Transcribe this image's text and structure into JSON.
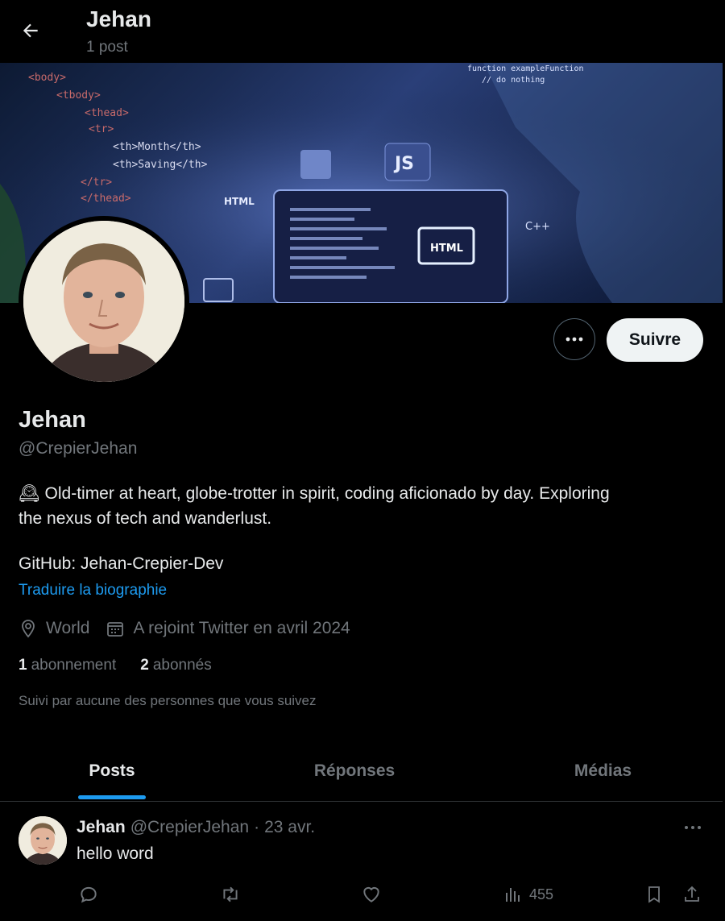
{
  "header": {
    "title": "Jehan",
    "subtitle": "1 post"
  },
  "banner": {
    "code_lines": [
      "<body>",
      "<tbody>",
      "<thead>",
      "<tr>",
      "<th>Month</th>",
      "<th>Saving</th>",
      "</tr>",
      "</thead>",
      "JS",
      "HTML",
      "HTML",
      "C++",
      "function exampleFunction",
      "// do nothing"
    ]
  },
  "profile": {
    "name": "Jehan",
    "handle": "@CrepierJehan",
    "bio_emoji": "🕰",
    "bio_line1": "Old-timer at heart, globe-trotter in spirit, coding aficionado by day. Exploring",
    "bio_line2": "the nexus of tech and wanderlust.",
    "github": "GitHub: Jehan-Crepier-Dev",
    "translate": "Traduire la biographie",
    "location": "World",
    "joined": "A rejoint Twitter en avril 2024",
    "following_count": "1",
    "following_label": "abonnement",
    "followers_count": "2",
    "followers_label": "abonnés",
    "followed_by": "Suivi par aucune des personnes que vous suivez"
  },
  "buttons": {
    "follow": "Suivre"
  },
  "tabs": [
    {
      "label": "Posts",
      "active": true
    },
    {
      "label": "Réponses",
      "active": false
    },
    {
      "label": "Médias",
      "active": false
    }
  ],
  "post": {
    "name": "Jehan",
    "handle": "@CrepierJehan",
    "separator": "·",
    "date": "23 avr.",
    "text": "hello word",
    "views": "455"
  },
  "colors": {
    "accent": "#1d9bf0",
    "background": "#000000",
    "muted": "#71767b"
  }
}
